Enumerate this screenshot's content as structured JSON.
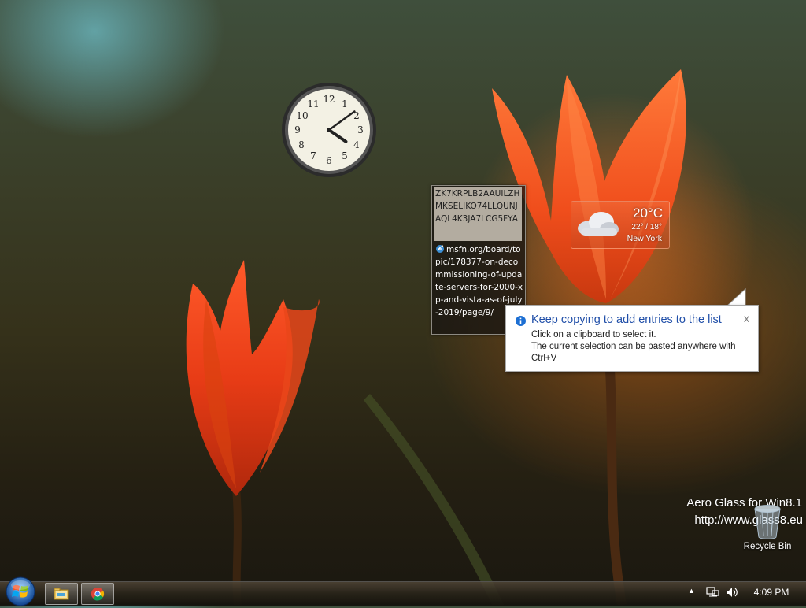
{
  "clipboard": {
    "entries": [
      {
        "text": "ZK7KRPLB2AAUILZHMKSELIKO74LLQUNJAQL4K3JA7LCG5FYA"
      },
      {
        "icon": "ie-icon",
        "text": "msfn.org/board/topic/178377-on-decommissioning-of-update-servers-for-2000-xp-and-vista-as-of-july-2019/page/9/"
      }
    ]
  },
  "weather": {
    "icon": "cloud-icon",
    "temperature": "20°C",
    "range": "22° / 18°",
    "city": "New York"
  },
  "clock": {
    "hour": 4,
    "minute": 9
  },
  "balloon": {
    "icon": "info-icon",
    "title": "Keep copying to add entries to the list",
    "close": "x",
    "line1": "Click on a clipboard to select it.",
    "line2": "The current selection can be pasted anywhere with",
    "line3": "Ctrl+V"
  },
  "watermark": {
    "line1": "Aero Glass for Win8.1",
    "line2": "http://www.glass8.eu"
  },
  "desktop": {
    "recycle_bin": {
      "label": "Recycle Bin",
      "icon": "recycle-bin-icon"
    }
  },
  "taskbar": {
    "start": {
      "icon": "windows-start-orb-icon"
    },
    "pinned": [
      {
        "name": "explorer",
        "icon": "folder-icon"
      },
      {
        "name": "chrome",
        "icon": "chrome-icon"
      }
    ],
    "tray": {
      "overflow_arrow": "▲",
      "network_icon": "network-icon",
      "volume_icon": "volume-icon",
      "time": "4:09 PM"
    }
  }
}
